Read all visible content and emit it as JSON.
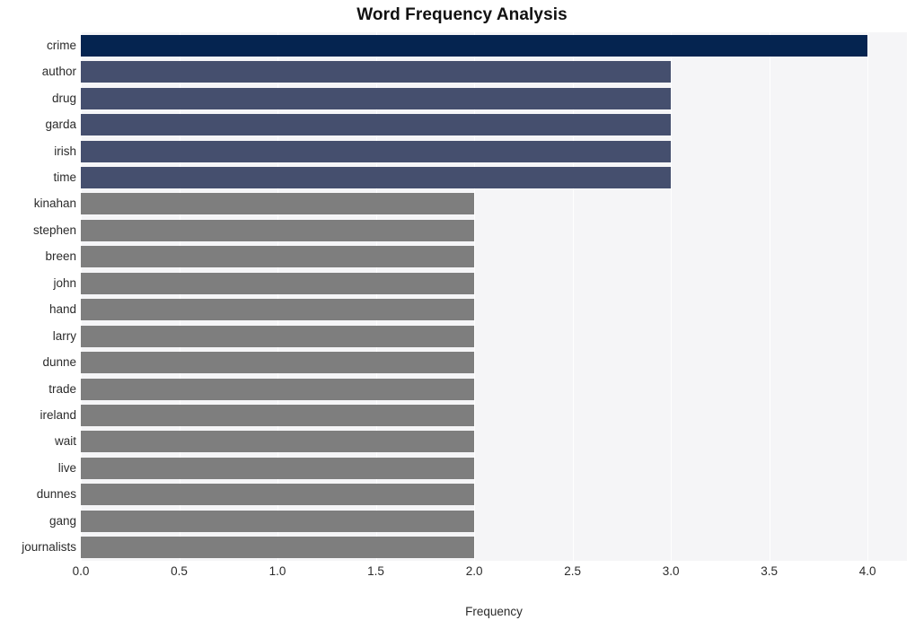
{
  "chart_data": {
    "type": "bar",
    "orientation": "horizontal",
    "title": "Word Frequency Analysis",
    "xlabel": "Frequency",
    "ylabel": "",
    "xlim": [
      0.0,
      4.2
    ],
    "xticks": [
      "0.0",
      "0.5",
      "1.0",
      "1.5",
      "2.0",
      "2.5",
      "3.0",
      "3.5",
      "4.0"
    ],
    "xtick_values": [
      0.0,
      0.5,
      1.0,
      1.5,
      2.0,
      2.5,
      3.0,
      3.5,
      4.0
    ],
    "grid": true,
    "legend": "none",
    "categories": [
      "crime",
      "author",
      "drug",
      "garda",
      "irish",
      "time",
      "kinahan",
      "stephen",
      "breen",
      "john",
      "hand",
      "larry",
      "dunne",
      "trade",
      "ireland",
      "wait",
      "live",
      "dunnes",
      "gang",
      "journalists"
    ],
    "values": [
      4,
      3,
      3,
      3,
      3,
      3,
      2,
      2,
      2,
      2,
      2,
      2,
      2,
      2,
      2,
      2,
      2,
      2,
      2,
      2
    ],
    "bar_colors": [
      "#052450",
      "#454f6e",
      "#454f6e",
      "#454f6e",
      "#454f6e",
      "#454f6e",
      "#7e7e7e",
      "#7e7e7e",
      "#7e7e7e",
      "#7e7e7e",
      "#7e7e7e",
      "#7e7e7e",
      "#7e7e7e",
      "#7e7e7e",
      "#7e7e7e",
      "#7e7e7e",
      "#7e7e7e",
      "#7e7e7e",
      "#7e7e7e",
      "#7e7e7e"
    ],
    "colors": {
      "highest": "#052450",
      "mid": "#454f6e",
      "low": "#7e7e7e",
      "plot_background": "#f5f5f7",
      "figure_background": "#ffffff",
      "gridline": "#ffffff",
      "text": "#2b2b2b",
      "title_text": "#111111"
    }
  }
}
